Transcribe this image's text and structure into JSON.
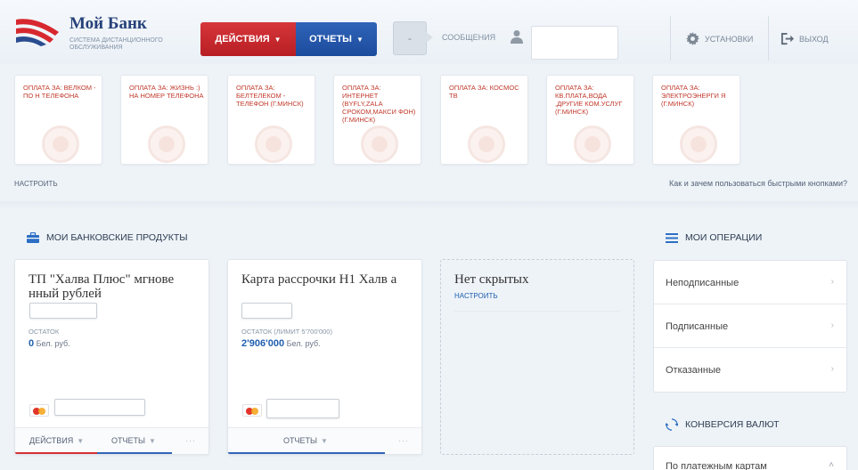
{
  "header": {
    "logo_title": "Мой Банк",
    "logo_subtitle": "Система дистанционного обслуживания",
    "actions_label": "ДЕЙСТВИЯ",
    "reports_label": "ОТЧЕТЫ",
    "messages_count": "-",
    "messages_label": "СООБЩЕНИЯ",
    "settings_label": "УСТАНОВКИ",
    "logout_label": "ВЫХОД"
  },
  "quick_tiles": {
    "items": [
      {
        "label": "ОПЛАТА ЗА: ВЕЛКОМ - ПО Н ТЕЛЕФОНА"
      },
      {
        "label": "ОПЛАТА ЗА: ЖИЗНЬ :) НА НОМЕР ТЕЛЕФОНА"
      },
      {
        "label": "ОПЛАТА ЗА: БЕЛТЕЛЕКОМ - ТЕЛЕФОН (Г.МИНСК)"
      },
      {
        "label": "ОПЛАТА ЗА: ИНТЕРНЕТ (BYFLY,ZALA СРОКОМ,МАКСИ ФОН) (Г.МИНСК)"
      },
      {
        "label": "ОПЛАТА ЗА: КОСМОС ТВ"
      },
      {
        "label": "ОПЛАТА ЗА: КВ.ПЛАТА,ВОДА ,ДРУГИЕ КОМ.УСЛУГ (Г.МИНСК)"
      },
      {
        "label": "ОПЛАТА ЗА: ЭЛЕКТРОЭНЕРГИ Я (Г.МИНСК)"
      }
    ],
    "configure_label": "НАСТРОИТЬ",
    "help_link": "Как и зачем пользоваться быстрыми кнопками?"
  },
  "products": {
    "title": "МОИ БАНКОВСКИЕ ПРОДУКТЫ",
    "cards": [
      {
        "title": "ТП \"Халва Плюс\" мгнове нный рублей",
        "balance_label": "ОСТАТОК",
        "balance_value": "0",
        "currency": "Бел. руб.",
        "actions_label": "ДЕЙСТВИЯ",
        "reports_label": "ОТЧЕТЫ",
        "more": "···"
      },
      {
        "title": "Карта рассрочки Н1 Халв а",
        "balance_label": "ОСТАТОК (ЛИМИТ 5'700'000)",
        "balance_value": "2'906'000",
        "currency": "Бел. руб.",
        "reports_label": "ОТЧЕТЫ",
        "more": "···"
      }
    ],
    "hidden": {
      "title": "Нет скрытых",
      "configure_label": "НАСТРОИТЬ"
    }
  },
  "operations": {
    "title": "МОИ ОПЕРАЦИИ",
    "items": [
      {
        "label": "Неподписанные"
      },
      {
        "label": "Подписанные"
      },
      {
        "label": "Отказанные"
      }
    ]
  },
  "conversion": {
    "title": "КОНВЕРСИЯ ВАЛЮТ",
    "item_label": "По платежным картам"
  },
  "colors": {
    "actions_red": "#c0272d",
    "reports_blue": "#2558ad",
    "tile_text_red": "#c0392b",
    "link_blue": "#1f5fb0"
  }
}
